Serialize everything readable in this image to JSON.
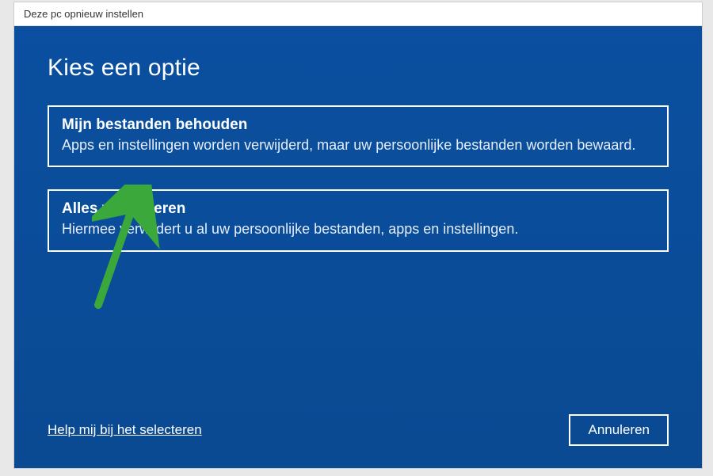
{
  "window": {
    "title": "Deze pc opnieuw instellen"
  },
  "heading": "Kies een optie",
  "options": [
    {
      "title": "Mijn bestanden behouden",
      "description": "Apps en instellingen worden verwijderd, maar uw persoonlijke bestanden worden bewaard."
    },
    {
      "title": "Alles verwijderen",
      "description": "Hiermee verwijdert u al uw persoonlijke bestanden, apps en instellingen."
    }
  ],
  "help_link": "Help mij bij het selecteren",
  "cancel_label": "Annuleren",
  "colors": {
    "blue": "#0a4e9b",
    "arrow": "#3aa83a"
  }
}
